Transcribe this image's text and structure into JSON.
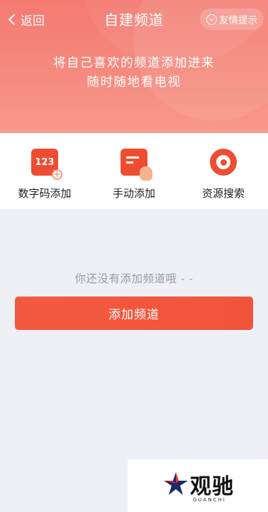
{
  "header": {
    "back_label": "返回",
    "title": "自建频道",
    "tip_label": "友情提示",
    "slogan_line1": "将自己喜欢的频道添加进来",
    "slogan_line2": "随时随地看电视"
  },
  "options": [
    {
      "label": "数字码添加",
      "icon": "digit-code-icon",
      "icon_text": "123"
    },
    {
      "label": "手动添加",
      "icon": "manual-add-icon"
    },
    {
      "label": "资源搜索",
      "icon": "resource-search-icon"
    }
  ],
  "empty_text": "你还没有添加频道哦 - -",
  "add_button_label": "添加频道",
  "watermark": {
    "brand": "观驰",
    "sub": "GUANCHI"
  },
  "colors": {
    "accent": "#ef4d32",
    "header": "#f47a70",
    "background": "#eef0f5"
  }
}
